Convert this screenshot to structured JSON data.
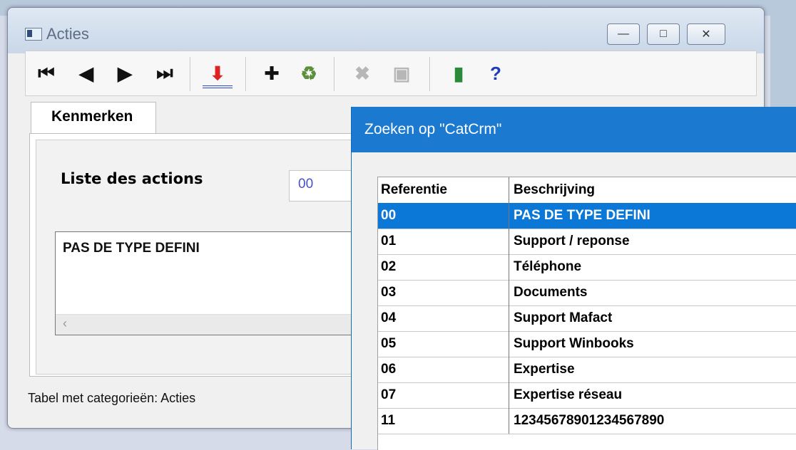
{
  "window": {
    "title": "Acties",
    "min_glyph": "—",
    "max_glyph": "□",
    "close_glyph": "✕"
  },
  "toolbar": {
    "first": "⏮",
    "prev": "◀",
    "next": "▶",
    "last": "⏭",
    "insert": "⬇",
    "add": "✚",
    "recycle": "♻",
    "delete": "✖",
    "save": "▣",
    "exit": "▮",
    "help": "?"
  },
  "tabs": [
    {
      "label": "Kenmerken"
    }
  ],
  "form": {
    "label": "Liste des actions",
    "code_value": "00",
    "description": "PAS DE TYPE DEFINI",
    "scroll_left": "‹"
  },
  "statusbar": {
    "text": "Tabel met categorieën: Acties"
  },
  "popup": {
    "title": "Zoeken op \"CatCrm\"",
    "columns": [
      "Referentie",
      "Beschrijving"
    ],
    "rows": [
      {
        "ref": "00",
        "desc": "PAS DE TYPE DEFINI",
        "selected": true
      },
      {
        "ref": "01",
        "desc": "Support / reponse"
      },
      {
        "ref": "02",
        "desc": "Téléphone"
      },
      {
        "ref": "03",
        "desc": "Documents"
      },
      {
        "ref": "04",
        "desc": "Support Mafact"
      },
      {
        "ref": "05",
        "desc": "Support Winbooks"
      },
      {
        "ref": "06",
        "desc": "Expertise"
      },
      {
        "ref": "07",
        "desc": "Expertise réseau"
      },
      {
        "ref": "11",
        "desc": "12345678901234567890"
      }
    ]
  }
}
